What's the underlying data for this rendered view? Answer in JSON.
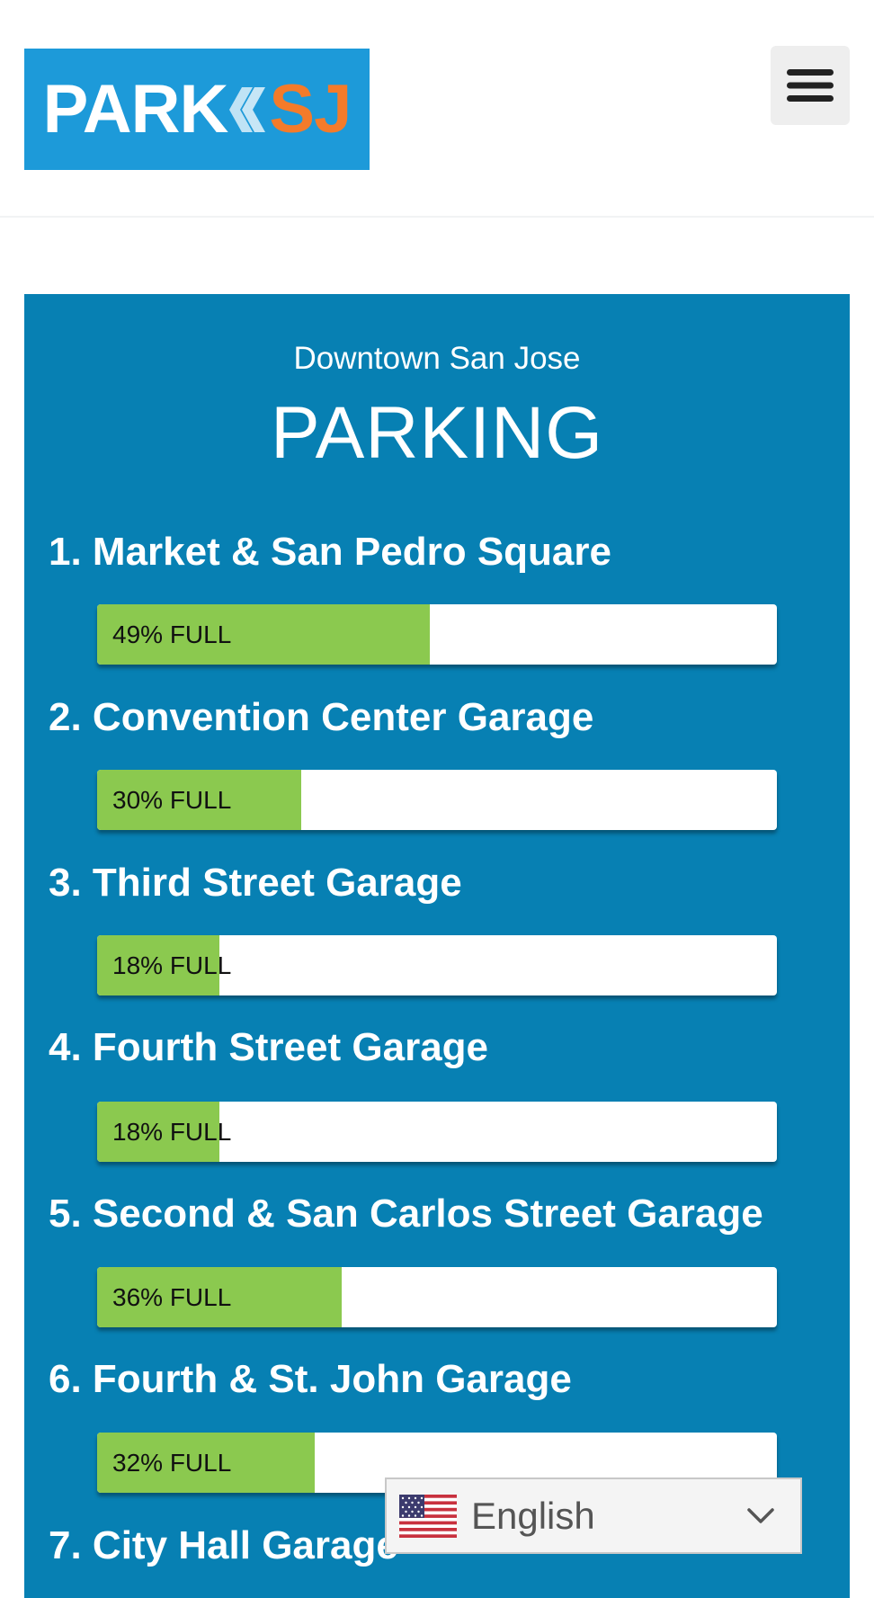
{
  "header": {
    "logo_text": "PARKSJ",
    "menu_icon": "hamburger-icon"
  },
  "parking": {
    "subtitle": "Downtown San Jose",
    "title": "PARKING",
    "garages": [
      {
        "name": "1. Market & San Pedro Square",
        "occupancy_percent": 49,
        "label": "49% FULL"
      },
      {
        "name": "2. Convention Center Garage",
        "occupancy_percent": 30,
        "label": "30% FULL"
      },
      {
        "name": "3. Third Street Garage",
        "occupancy_percent": 18,
        "label": "18% FULL"
      },
      {
        "name": "4. Fourth Street Garage",
        "occupancy_percent": 18,
        "label": "18% FULL"
      },
      {
        "name": "5. Second & San Carlos Street Garage",
        "occupancy_percent": 36,
        "label": "36% FULL"
      },
      {
        "name": "6. Fourth & St. John Garage",
        "occupancy_percent": 32,
        "label": "32% FULL"
      },
      {
        "name": "7. City Hall Garage",
        "occupancy_percent": null,
        "label": ""
      }
    ]
  },
  "language": {
    "selected": "English",
    "flag_icon": "us-flag-icon",
    "chevron_icon": "chevron-down-icon"
  },
  "colors": {
    "logo_bg": "#1d9ad9",
    "logo_accent": "#f47b2a",
    "panel_bg": "#0780b3",
    "bar_fill": "#8bc94f"
  }
}
